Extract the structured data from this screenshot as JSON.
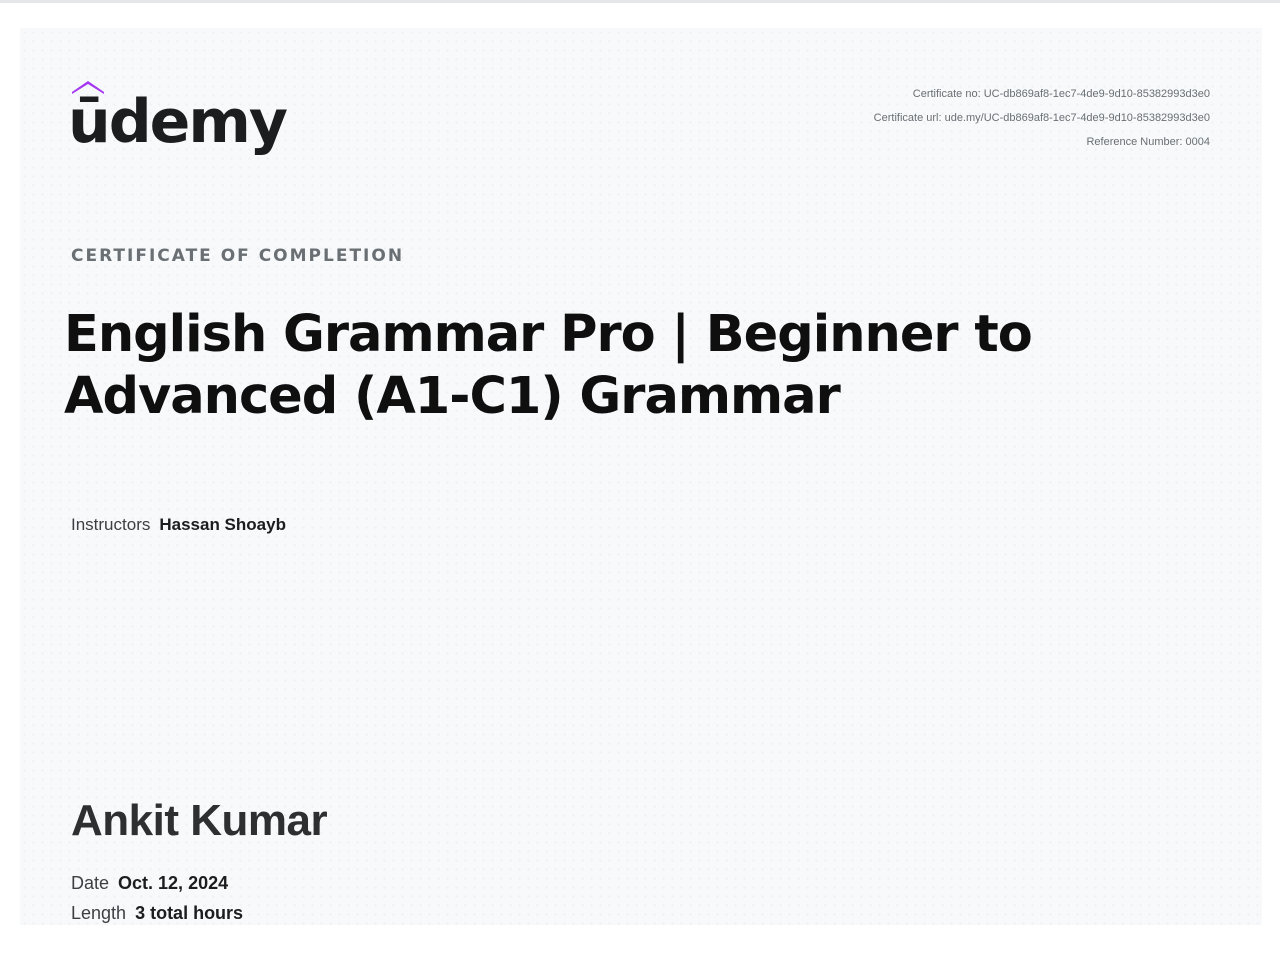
{
  "logo": {
    "text": "ūdemy",
    "accent": "#a435f0",
    "text_color": "#1c1d1f"
  },
  "certificate": {
    "number_line": "Certificate no: UC-db869af8-1ec7-4de9-9d10-85382993d3e0",
    "url_line": "Certificate url: ude.my/UC-db869af8-1ec7-4de9-9d10-85382993d3e0",
    "reference_line": "Reference Number: 0004",
    "kicker": "CERTIFICATE OF COMPLETION",
    "course_title_line1": "English Grammar Pro | Beginner to",
    "course_title_line2": "Advanced (A1-C1) Grammar",
    "instructors_label": "Instructors",
    "instructors_value": "Hassan Shoayb",
    "recipient_name": "Ankit Kumar",
    "date_label": "Date",
    "date_value": "Oct. 12, 2024",
    "length_label": "Length",
    "length_value": "3 total hours"
  }
}
